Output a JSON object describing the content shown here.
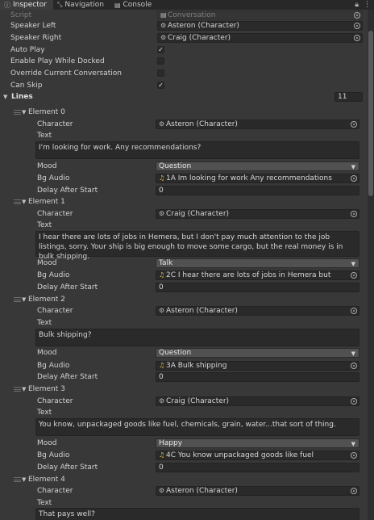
{
  "tabs": [
    {
      "label": "Inspector",
      "icon": "info-icon",
      "active": true
    },
    {
      "label": "Navigation",
      "icon": "navigation-icon",
      "active": false
    },
    {
      "label": "Console",
      "icon": "console-icon",
      "active": false
    }
  ],
  "props": {
    "script_label": "Script",
    "script_value": "Conversation",
    "speaker_left_label": "Speaker Left",
    "speaker_left_value": "Asteron (Character)",
    "speaker_right_label": "Speaker Right",
    "speaker_right_value": "Craig (Character)",
    "auto_play_label": "Auto Play",
    "auto_play": true,
    "enable_docked_label": "Enable Play While Docked",
    "enable_docked": false,
    "override_label": "Override Current Conversation",
    "override": false,
    "can_skip_label": "Can Skip",
    "can_skip": true
  },
  "lines": {
    "label": "Lines",
    "size": "11",
    "field_labels": {
      "character": "Character",
      "text": "Text",
      "mood": "Mood",
      "bg_audio": "Bg Audio",
      "delay": "Delay After Start"
    },
    "elements": [
      {
        "name": "Element 0",
        "character": "Asteron (Character)",
        "text": "I'm looking for work. Any recommendations?",
        "mood": "Question",
        "bg_audio": "1A Im looking for work Any recommendations",
        "delay": "0"
      },
      {
        "name": "Element 1",
        "character": "Craig (Character)",
        "text": "I hear there are lots of jobs in Hemera, but I don't pay much attention to the job listings, sorry. Your ship is big enough to move some cargo, but the real money is in bulk shipping.",
        "mood": "Talk",
        "bg_audio": "2C I hear there are lots of jobs in Hemera but",
        "delay": "0"
      },
      {
        "name": "Element 2",
        "character": "Asteron (Character)",
        "text": "Bulk shipping?",
        "mood": "Question",
        "bg_audio": "3A Bulk shipping",
        "delay": "0"
      },
      {
        "name": "Element 3",
        "character": "Craig (Character)",
        "text": "You know, unpackaged goods like fuel, chemicals, grain, water...that sort of thing.",
        "mood": "Happy",
        "bg_audio": "4C You know unpackaged goods like fuel",
        "delay": "0"
      },
      {
        "name": "Element 4",
        "character": "Asteron (Character)",
        "text": "That pays well?"
      }
    ]
  }
}
